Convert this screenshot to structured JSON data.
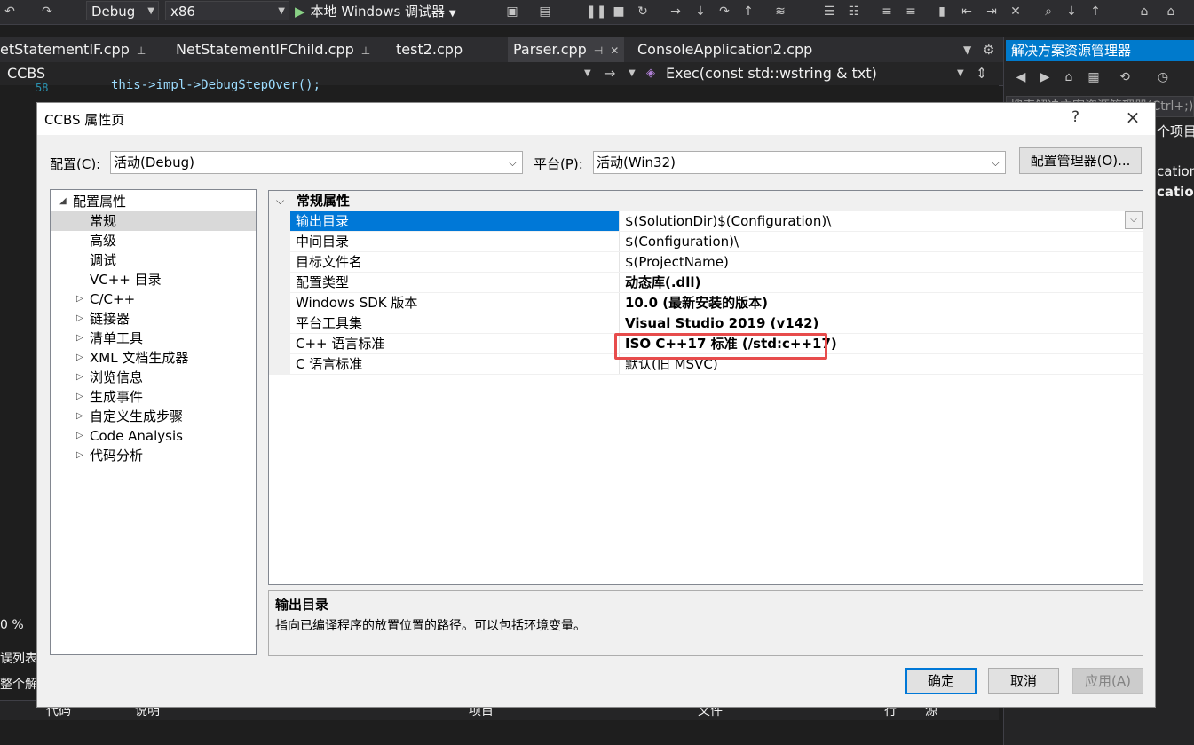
{
  "toolbar": {
    "config": "Debug",
    "platform": "x86",
    "run": "本地 Windows 调试器"
  },
  "tabs": [
    {
      "label": "etStatementIF.cpp",
      "pinned": true
    },
    {
      "label": "NetStatementIFChild.cpp",
      "pinned": true
    },
    {
      "label": "test2.cpp",
      "pinned": false
    },
    {
      "label": "Parser.cpp",
      "pinned": true,
      "active": true
    },
    {
      "label": "ConsoleApplication2.cpp",
      "pinned": false
    }
  ],
  "navbar": {
    "project": "CCBS",
    "member": "Exec(const std::wstring & txt)"
  },
  "editor": {
    "line": "58",
    "code": "this->impl->DebugStepOver();"
  },
  "solution_explorer": {
    "title": "解决方案资源管理器",
    "search": "搜索解决方案资源管理器(Ctrl+;)",
    "lines": [
      "个项目",
      "cation",
      "cation"
    ]
  },
  "ide_bottom": {
    "zoom": "0 %",
    "error_list": "误列表",
    "scope": "整个解",
    "columns": [
      "代码",
      "说明",
      "项目",
      "文件",
      "行",
      "源"
    ]
  },
  "dialog": {
    "title": "CCBS 属性页",
    "help": "?",
    "close": "×",
    "config_label": "配置(C):",
    "config_value": "活动(Debug)",
    "platform_label": "平台(P):",
    "platform_value": "活动(Win32)",
    "config_manager": "配置管理器(O)...",
    "tree": [
      {
        "label": "配置属性",
        "level": 0,
        "expander": "open"
      },
      {
        "label": "常规",
        "level": 1,
        "selected": true
      },
      {
        "label": "高级",
        "level": 1
      },
      {
        "label": "调试",
        "level": 1
      },
      {
        "label": "VC++ 目录",
        "level": 1
      },
      {
        "label": "C/C++",
        "level": 1,
        "expander": "closed"
      },
      {
        "label": "链接器",
        "level": 1,
        "expander": "closed"
      },
      {
        "label": "清单工具",
        "level": 1,
        "expander": "closed"
      },
      {
        "label": "XML 文档生成器",
        "level": 1,
        "expander": "closed"
      },
      {
        "label": "浏览信息",
        "level": 1,
        "expander": "closed"
      },
      {
        "label": "生成事件",
        "level": 1,
        "expander": "closed"
      },
      {
        "label": "自定义生成步骤",
        "level": 1,
        "expander": "closed"
      },
      {
        "label": "Code Analysis",
        "level": 1,
        "expander": "closed"
      },
      {
        "label": "代码分析",
        "level": 1,
        "expander": "closed"
      }
    ],
    "grid_category": "常规属性",
    "grid_rows": [
      {
        "name": "输出目录",
        "value": "$(SolutionDir)$(Configuration)\\",
        "bold": false,
        "selected": true
      },
      {
        "name": "中间目录",
        "value": "$(Configuration)\\",
        "bold": false
      },
      {
        "name": "目标文件名",
        "value": "$(ProjectName)",
        "bold": false
      },
      {
        "name": "配置类型",
        "value": "动态库(.dll)",
        "bold": true
      },
      {
        "name": "Windows SDK 版本",
        "value": "10.0 (最新安装的版本)",
        "bold": true
      },
      {
        "name": "平台工具集",
        "value": "Visual Studio 2019 (v142)",
        "bold": true
      },
      {
        "name": "C++ 语言标准",
        "value": "ISO C++17 标准 (/std:c++17)",
        "bold": true
      },
      {
        "name": "C 语言标准",
        "value": "默认(旧 MSVC)",
        "bold": false
      }
    ],
    "description_title": "输出目录",
    "description_text": "指向已编译程序的放置位置的路径。可以包括环境变量。",
    "ok": "确定",
    "cancel": "取消",
    "apply": "应用(A)",
    "highlight_color": "#e74c4c",
    "accent_color": "#0078d7"
  }
}
